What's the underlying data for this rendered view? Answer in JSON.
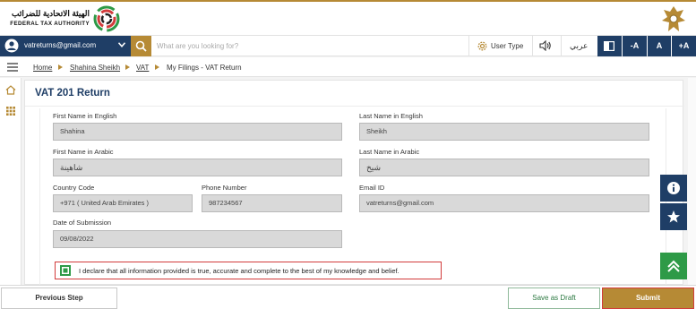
{
  "header": {
    "logo_text_ar": "الهيئة الاتحادية للضرائب",
    "logo_text_en": "FEDERAL TAX AUTHORITY"
  },
  "navbar": {
    "user_email": "vatreturns@gmail.com",
    "search_placeholder": "What are you looking for?",
    "user_type_label": "User Type",
    "language_label": "عربي",
    "font_decrease_label": "-A",
    "font_normal_label": "A",
    "font_increase_label": "+A"
  },
  "breadcrumb": {
    "items": [
      "Home",
      "Shahina Sheikh",
      "VAT",
      "My Filings - VAT Return"
    ]
  },
  "main": {
    "title": "VAT 201 Return",
    "fields": {
      "first_name_en": {
        "label": "First Name in English",
        "value": "Shahina"
      },
      "last_name_en": {
        "label": "Last Name in English",
        "value": "Sheikh"
      },
      "first_name_ar": {
        "label": "First Name in Arabic",
        "value": "شاهينة"
      },
      "last_name_ar": {
        "label": "Last Name in Arabic",
        "value": "شيخ"
      },
      "country_code": {
        "label": "Country Code",
        "value": "+971 ( United Arab Emirates )"
      },
      "phone_number": {
        "label": "Phone Number",
        "value": "987234567"
      },
      "email_id": {
        "label": "Email ID",
        "value": "vatreturns@gmail.com"
      },
      "date_of_submission": {
        "label": "Date of Submission",
        "value": "09/08/2022"
      }
    },
    "declaration": {
      "checked": true,
      "text": "I declare that all information provided is true, accurate and complete to the best of my knowledge and belief."
    }
  },
  "footer": {
    "previous_label": "Previous Step",
    "save_draft_label": "Save as Draft",
    "submit_label": "Submit"
  },
  "colors": {
    "navy": "#1f3e66",
    "gold": "#b68a35",
    "green": "#2e9a47",
    "highlight_red": "#d23b3b"
  }
}
